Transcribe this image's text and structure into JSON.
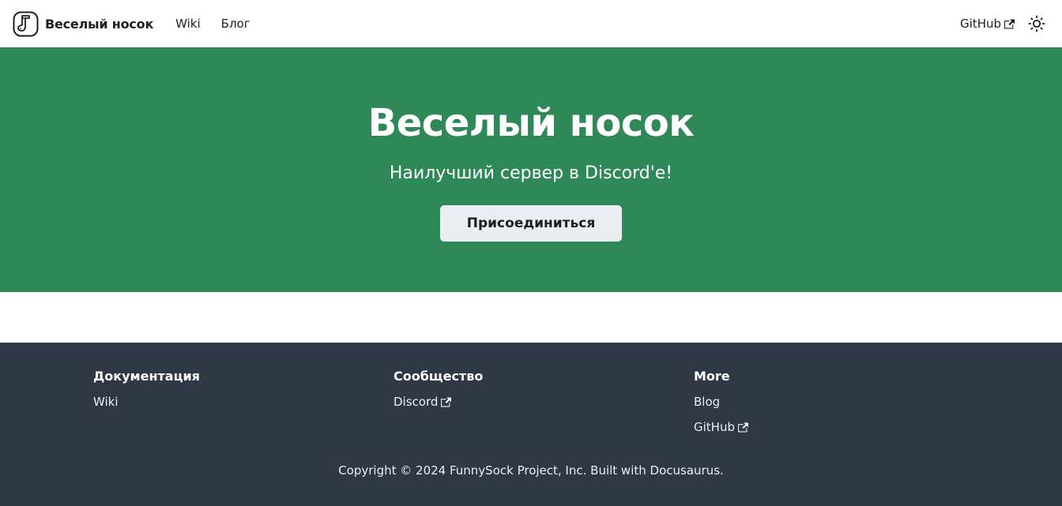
{
  "navbar": {
    "brand_title": "Веселый носок",
    "links": [
      {
        "label": "Wiki"
      },
      {
        "label": "Блог"
      }
    ],
    "github_label": "GitHub",
    "icons": {
      "logo": "sock-logo-icon",
      "external": "external-link-icon",
      "theme": "sun-icon"
    }
  },
  "hero": {
    "title": "Веселый носок",
    "subtitle": "Наилучший сервер в Discord'е!",
    "button_label": "Присоединиться"
  },
  "footer": {
    "columns": [
      {
        "title": "Документация",
        "links": [
          {
            "label": "Wiki"
          }
        ]
      },
      {
        "title": "Сообщество",
        "links": [
          {
            "label": "Discord"
          }
        ]
      },
      {
        "title": "More",
        "links": [
          {
            "label": "Blog"
          },
          {
            "label": "GitHub"
          }
        ]
      }
    ],
    "copyright": "Copyright © 2024 FunnySock Project, Inc. Built with Docusaurus."
  },
  "colors": {
    "primary": "#2e8858",
    "footer_bg": "#303846",
    "button_bg": "#ebedf0",
    "text_dark": "#1c1e21"
  }
}
